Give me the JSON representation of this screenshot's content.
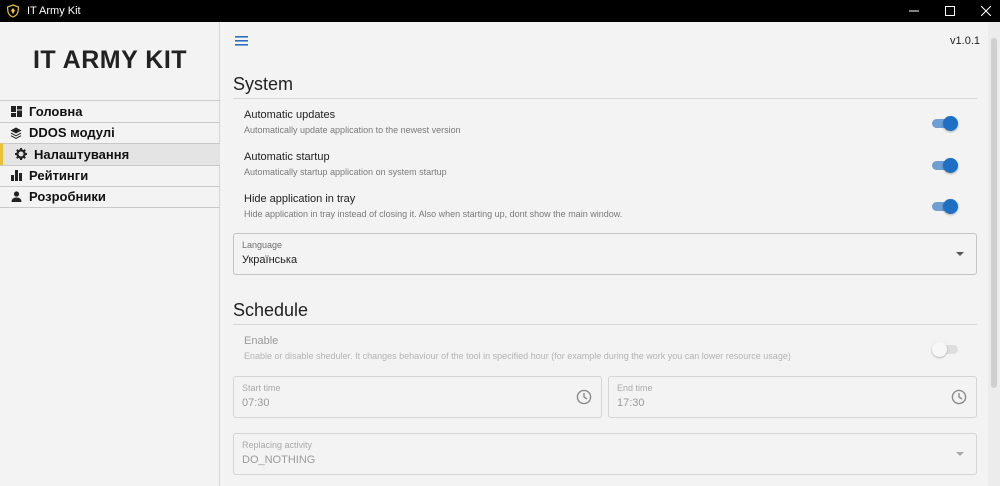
{
  "window": {
    "title": "IT Army Kit"
  },
  "sidebar": {
    "brand": "IT ARMY KIT",
    "items": [
      {
        "label": "Головна",
        "icon": "dashboard-icon"
      },
      {
        "label": "DDOS модулі",
        "icon": "layers-icon"
      },
      {
        "label": "Налаштування",
        "icon": "gear-icon",
        "active": true
      },
      {
        "label": "Рейтинги",
        "icon": "bar-chart-icon"
      },
      {
        "label": "Розробники",
        "icon": "person-icon"
      }
    ]
  },
  "header": {
    "version": "v1.0.1"
  },
  "system": {
    "title": "System",
    "settings": [
      {
        "title": "Automatic updates",
        "desc": "Automatically update application to the newest version",
        "enabled": true
      },
      {
        "title": "Automatic startup",
        "desc": "Automatically startup application on system startup",
        "enabled": true
      },
      {
        "title": "Hide application in tray",
        "desc": "Hide application in tray instead of closing it. Also when starting up, dont show the main window.",
        "enabled": true
      }
    ],
    "language": {
      "label": "Language",
      "value": "Українська"
    }
  },
  "schedule": {
    "title": "Schedule",
    "enable": {
      "title": "Enable",
      "desc": "Enable or disable sheduler. It changes behaviour of the tool in specified hour (for example during the work you can lower resource usage)",
      "enabled": false
    },
    "start_time": {
      "label": "Start time",
      "value": "07:30"
    },
    "end_time": {
      "label": "End time",
      "value": "17:30"
    },
    "replacing": {
      "label": "Replacing activity",
      "value": "DO_NOTHING"
    }
  },
  "colors": {
    "accent": "#1f6fc5",
    "active_marker": "#e8c33a",
    "titlebar": "#000000"
  }
}
